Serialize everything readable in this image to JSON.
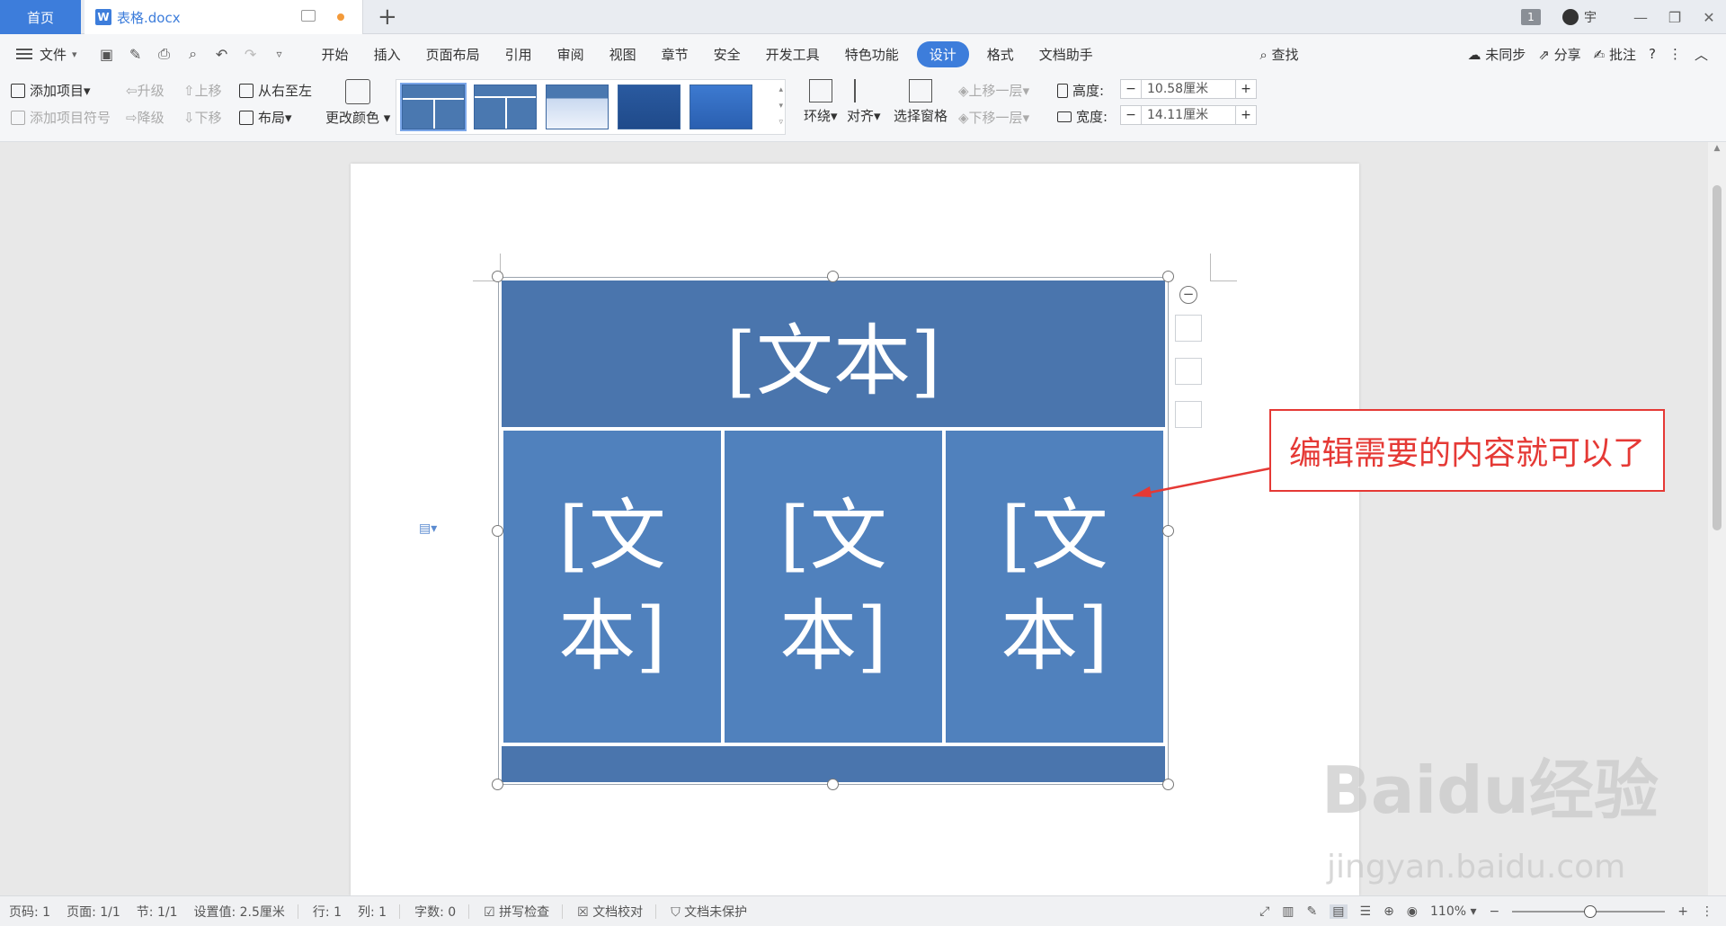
{
  "titlebar": {
    "home_tab": "首页",
    "doc_tab": "表格.docx",
    "doc_icon_letter": "W",
    "new_tab": "+",
    "badge": "1",
    "user": "宇"
  },
  "menubar": {
    "file": "文件",
    "items": [
      "开始",
      "插入",
      "页面布局",
      "引用",
      "审阅",
      "视图",
      "章节",
      "安全",
      "开发工具",
      "特色功能",
      "设计",
      "格式",
      "文档助手"
    ],
    "active_index": 10,
    "search": "查找",
    "sync": "未同步",
    "share": "分享",
    "comment": "批注"
  },
  "ribbon": {
    "add_item": "添加项目",
    "add_bullet": "添加项目符号",
    "promote": "升级",
    "demote": "降级",
    "move_up": "上移",
    "move_down": "下移",
    "right_to_left": "从右至左",
    "layout": "布局",
    "change_color": "更改颜色",
    "wrap": "环绕",
    "align": "对齐",
    "selection_pane": "选择窗格",
    "bring_forward": "上移一层",
    "send_backward": "下移一层",
    "height_label": "高度:",
    "height_value": "10.58厘米",
    "width_label": "宽度:",
    "width_value": "14.11厘米"
  },
  "smartart": {
    "top_text": "[文本]",
    "col1_text": "[文本]",
    "col2_text": "[文本]",
    "col3_text": "[文本]",
    "fill_color": "#4a75ad"
  },
  "callout": {
    "text": "编辑需要的内容就可以了",
    "color": "#e53935"
  },
  "statusbar": {
    "page_num": "页码: 1",
    "pages": "页面: 1/1",
    "section": "节: 1/1",
    "setting": "设置值: 2.5厘米",
    "row": "行: 1",
    "col": "列: 1",
    "word_count": "字数: 0",
    "spell_check": "拼写检查",
    "doc_proof": "文档校对",
    "doc_unprotected": "文档未保护",
    "zoom": "110%"
  },
  "watermark": {
    "brand": "Baidu经验",
    "url": "jingyan.baidu.com"
  }
}
